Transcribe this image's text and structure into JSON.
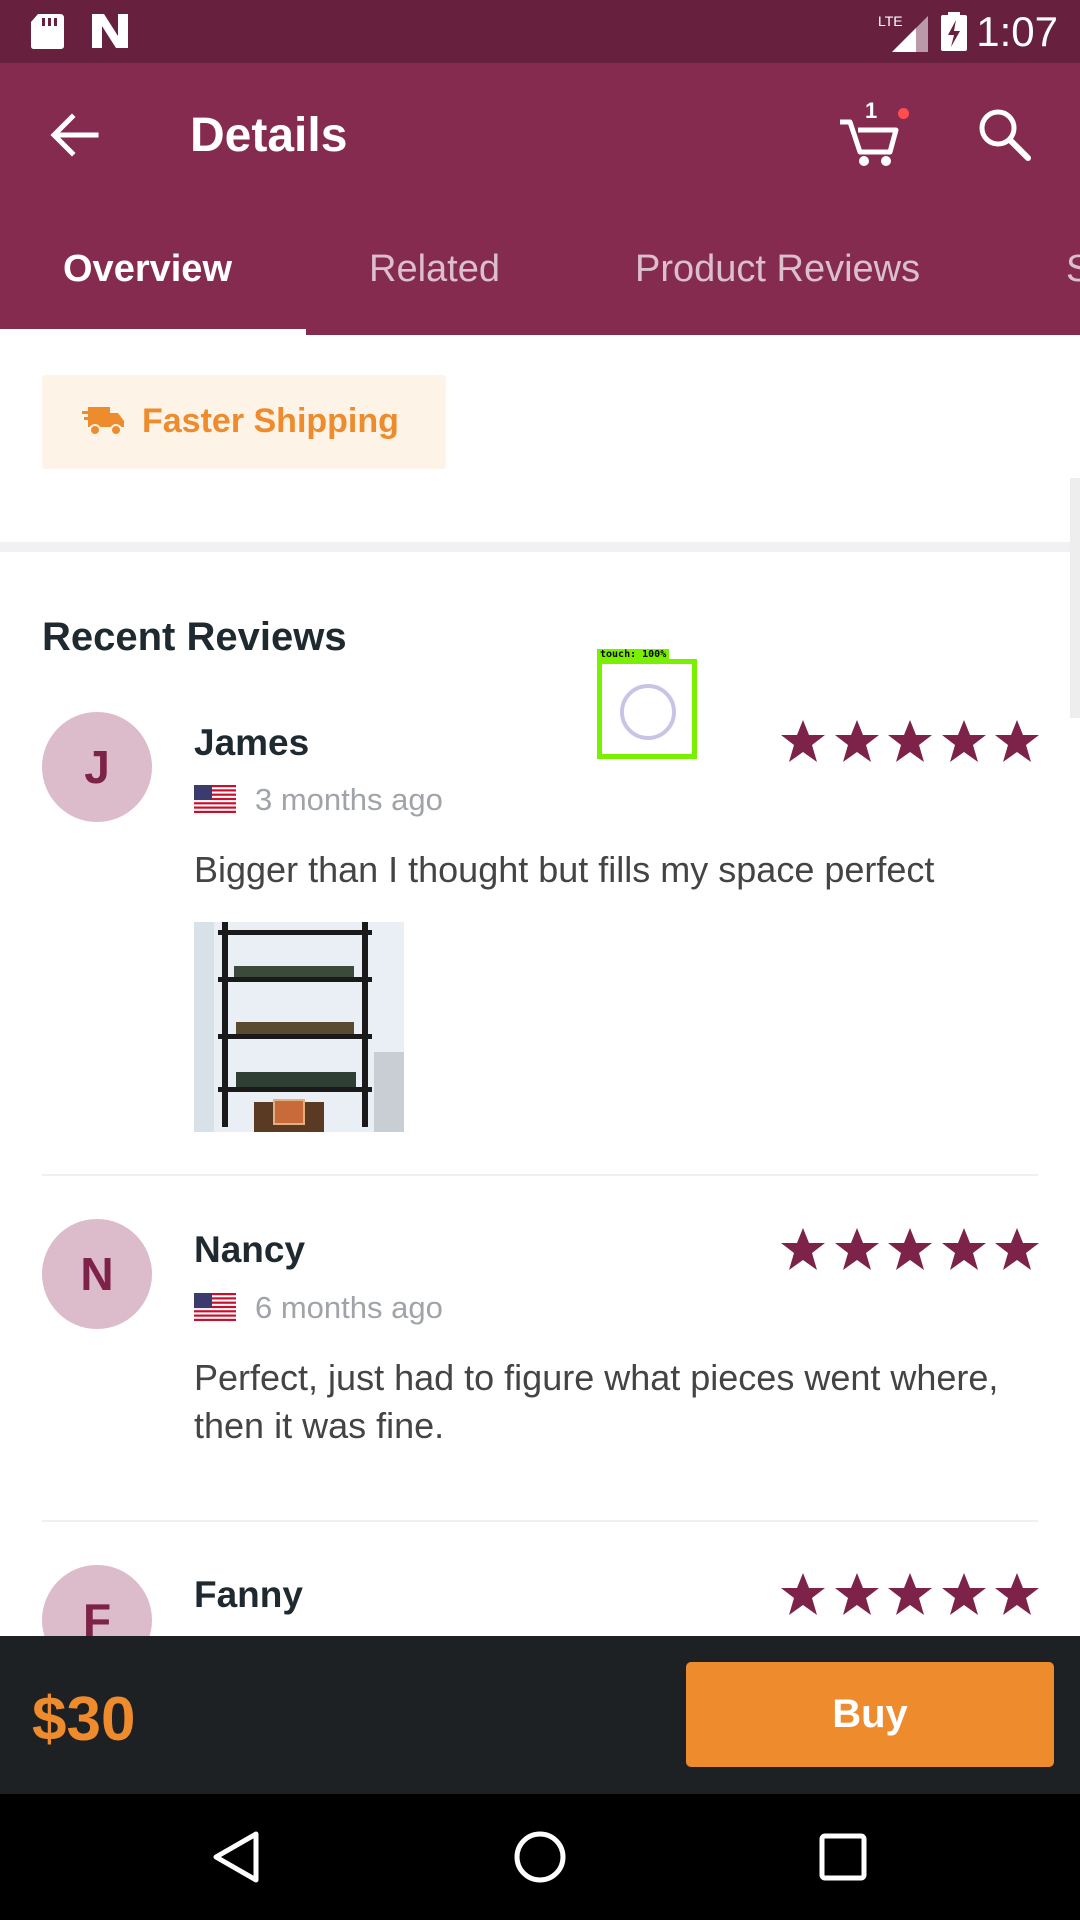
{
  "status_bar": {
    "time": "1:07",
    "icons": [
      "sd-card-icon",
      "notification-n-icon",
      "lte-signal-icon",
      "battery-charging-icon"
    ],
    "network": "LTE"
  },
  "app_bar": {
    "title": "Details",
    "cart_count": "1",
    "colors": {
      "status_bar": "#67203e",
      "app_bar": "#852b50",
      "accent": "#ee8b2d",
      "star": "#7d2248"
    }
  },
  "tabs": [
    {
      "label": "Overview",
      "active": true
    },
    {
      "label": "Related",
      "active": false
    },
    {
      "label": "Product Reviews",
      "active": false
    },
    {
      "label": "S",
      "active": false
    }
  ],
  "shipping": {
    "label": "Faster Shipping",
    "icon": "truck-icon"
  },
  "reviews_section": {
    "heading": "Recent Reviews",
    "items": [
      {
        "initial": "J",
        "name": "James",
        "time": "3 months ago",
        "country": "US",
        "rating": 5,
        "text": "Bigger than I thought but fills my space perfect",
        "has_photo": true
      },
      {
        "initial": "N",
        "name": "Nancy",
        "time": "6 months ago",
        "country": "US",
        "rating": 5,
        "text": "Perfect, just had to figure what pieces went where, then it was fine.",
        "has_photo": false
      },
      {
        "initial": "F",
        "name": "Fanny",
        "rating": 5
      }
    ]
  },
  "touch_overlay": {
    "label": "touch: 100%"
  },
  "bottom_bar": {
    "price": "$30",
    "buy_label": "Buy"
  }
}
